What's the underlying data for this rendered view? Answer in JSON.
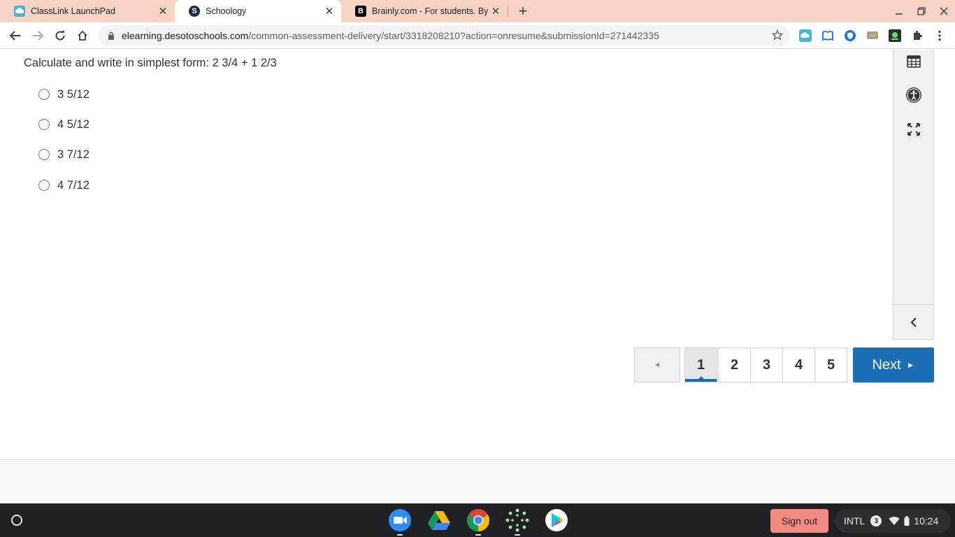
{
  "browser": {
    "tabs": [
      {
        "title": "ClassLink LaunchPad",
        "icon": "classlink-icon",
        "active": false
      },
      {
        "title": "Schoology",
        "icon": "schoology-icon",
        "active": true
      },
      {
        "title": "Brainly.com - For students. By students",
        "icon": "brainly-icon",
        "active": false
      }
    ],
    "url_host": "elearning.desotoschools.com",
    "url_path": "/common-assessment-delivery/start/3318208210?action=onresume&submissionId=271442335"
  },
  "question": {
    "prompt": "Calculate and write in simplest form: 2 3/4 + 1 2/3",
    "options": [
      "3 5/12",
      "4 5/12",
      "3 7/12",
      "4 7/12"
    ]
  },
  "pager": {
    "prev_symbol": "◄",
    "pages": [
      "1",
      "2",
      "3",
      "4",
      "5"
    ],
    "current_page": "1",
    "next_label": "Next",
    "next_symbol": "►"
  },
  "shelf": {
    "signout_label": "Sign out",
    "ime": "INTL",
    "notification_count": "3",
    "time": "10:24"
  },
  "colors": {
    "tabstrip": "#f8d4c4",
    "accent": "#1a6fb4",
    "signout": "#f28b82"
  }
}
